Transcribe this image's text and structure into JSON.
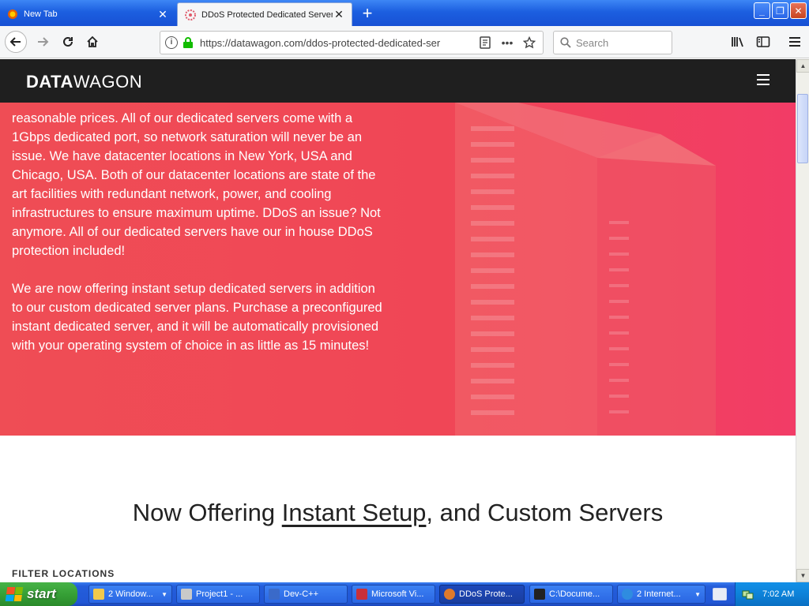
{
  "browser": {
    "tabs": [
      {
        "label": "New Tab",
        "active": false
      },
      {
        "label": "DDoS Protected Dedicated Servers",
        "active": true
      }
    ],
    "new_tab_symbol": "+",
    "url": "https://datawagon.com/ddos-protected-dedicated-ser",
    "search_placeholder": "Search",
    "window_controls": {
      "minimize": "_",
      "maximize": "❐",
      "close": "✕"
    }
  },
  "site": {
    "logo_bold": "DATA",
    "logo_light": "WAGON",
    "hero_paragraphs": [
      "reasonable prices. All of our dedicated servers come with a 1Gbps dedicated port, so network saturation will never be an issue. We have datacenter locations in New York, USA and Chicago, USA. Both of our datacenter locations are state of the art facilities with redundant network, power, and cooling infrastructures to ensure maximum uptime. DDoS an issue? Not anymore. All of our dedicated servers have our in house DDoS protection included!",
      "We are now offering instant setup dedicated servers in addition to our custom dedicated server plans. Purchase a preconfigured instant dedicated server, and it will be automatically provisioned with your operating system of choice in as little as 15 minutes!"
    ],
    "section_title_before": "Now Offering ",
    "section_title_link": "Instant Setup",
    "section_title_after": ", and Custom Servers",
    "filter_label": "FILTER LOCATIONS",
    "colors": {
      "hero_start": "#ef4d55",
      "hero_end": "#f23c66",
      "header_bg": "#1f1f1f"
    }
  },
  "taskbar": {
    "start_label": "start",
    "tasks": [
      {
        "label": "2 Window...",
        "icon_color": "#f2c94c",
        "caret": true
      },
      {
        "label": "Project1 - ...",
        "icon_color": "#c9c9c9",
        "caret": false
      },
      {
        "label": "Dev-C++",
        "icon_color": "#3a6ac9",
        "caret": false
      },
      {
        "label": "Microsoft Vi...",
        "icon_color": "#c9303a",
        "caret": false
      },
      {
        "label": "DDoS Prote...",
        "icon_color": "#e07a2a",
        "caret": false,
        "active": true
      },
      {
        "label": "C:\\Docume...",
        "icon_color": "#222222",
        "caret": false
      },
      {
        "label": "2 Internet...",
        "icon_color": "#2f8ce0",
        "caret": true
      }
    ],
    "clock": "7:02 AM"
  }
}
